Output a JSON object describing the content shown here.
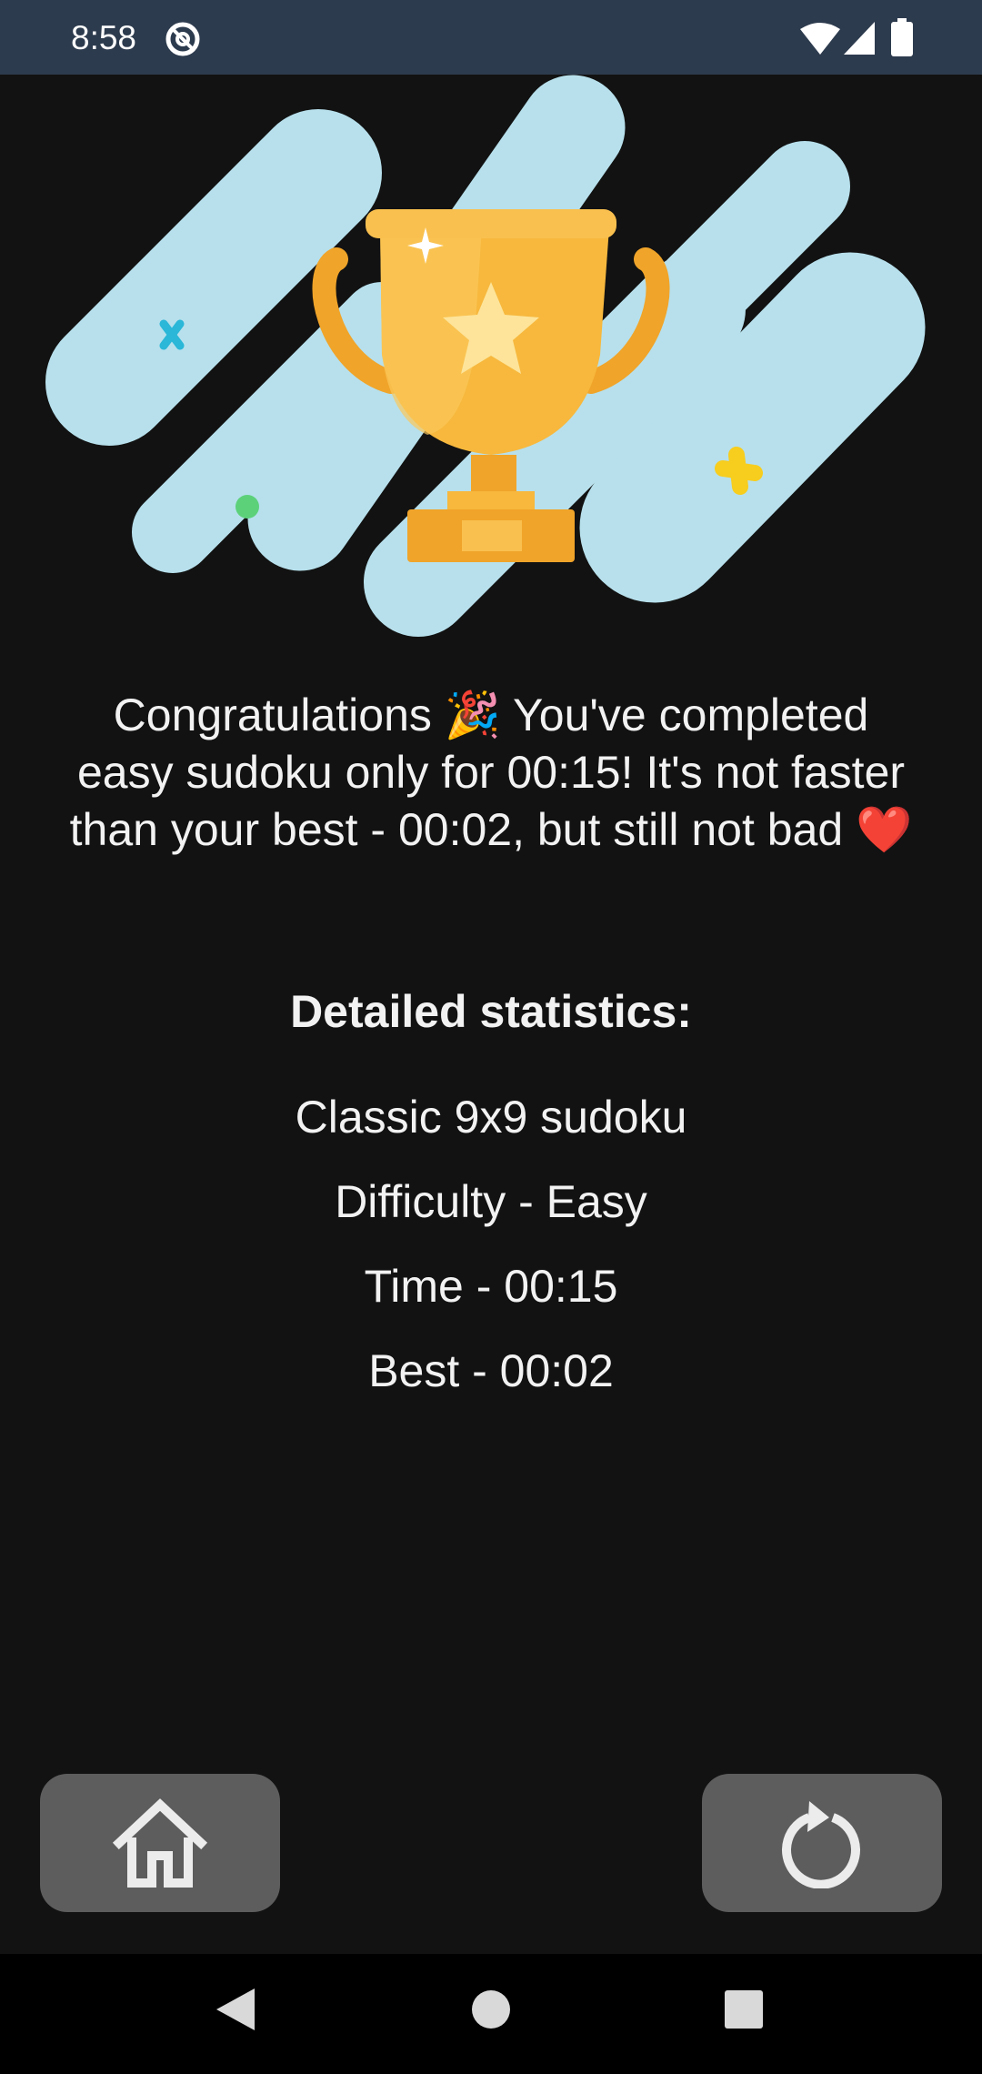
{
  "status_bar": {
    "time": "8:58",
    "icons": [
      "sync-icon",
      "wifi-icon",
      "signal-icon",
      "battery-icon"
    ]
  },
  "hero": {
    "image": "trophy-illustration",
    "colors": {
      "splash": "#b7e0ec",
      "trophy": "#f7b83d",
      "trophy_dark": "#f0a429",
      "star": "#fde49a"
    }
  },
  "result": {
    "message": "Congratulations 🎉 You've completed easy sudoku only for 00:15! It's not faster than your best - 00:02, but still not bad ❤️"
  },
  "statistics": {
    "heading": "Detailed statistics:",
    "game_type": "Classic 9x9 sudoku",
    "difficulty": "Difficulty - Easy",
    "time": "Time - 00:15",
    "best": "Best - 00:02"
  },
  "actions": {
    "home_icon": "home-icon",
    "restart_icon": "restart-icon",
    "button_color": "#5d5d5d"
  },
  "nav_bar": {
    "icons": [
      "back-icon",
      "home-circle-icon",
      "recents-icon"
    ]
  }
}
